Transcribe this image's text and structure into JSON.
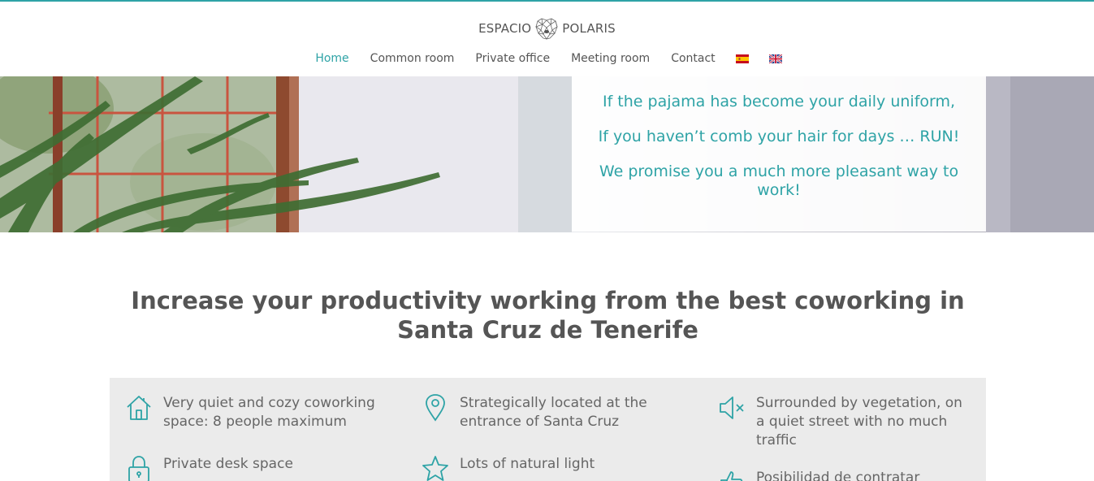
{
  "brand": {
    "left": "ESPACIO",
    "right": "POLARIS",
    "accent_color": "#2ea3a6"
  },
  "nav": {
    "items": [
      {
        "label": "Home",
        "active": true
      },
      {
        "label": "Common room",
        "active": false
      },
      {
        "label": "Private office",
        "active": false
      },
      {
        "label": "Meeting room",
        "active": false
      },
      {
        "label": "Contact",
        "active": false
      }
    ],
    "languages": [
      "spanish-flag-icon",
      "uk-flag-icon"
    ]
  },
  "hero": {
    "line1": "If the pajama has become your daily uniform,",
    "line2": "If you haven’t comb your hair for days … RUN!",
    "line3": "We promise you a much more pleasant way to work!"
  },
  "headline": "Increase your productivity working from the best coworking in Santa Cruz de Tenerife",
  "features": [
    {
      "icon": "home-icon",
      "text": "Very quiet and cozy coworking space: 8 people maximum"
    },
    {
      "icon": "location-pin-icon",
      "text": "Strategically located at the entrance of Santa Cruz"
    },
    {
      "icon": "speaker-mute-icon",
      "text": "Surrounded by vegetation, on a quiet street with no much traffic"
    },
    {
      "icon": "lock-icon",
      "text": "Private desk space"
    },
    {
      "icon": "star-icon",
      "text": "Lots of natural light"
    },
    {
      "icon": "thumbs-up-icon",
      "text": "Posibilidad de contratar"
    }
  ]
}
